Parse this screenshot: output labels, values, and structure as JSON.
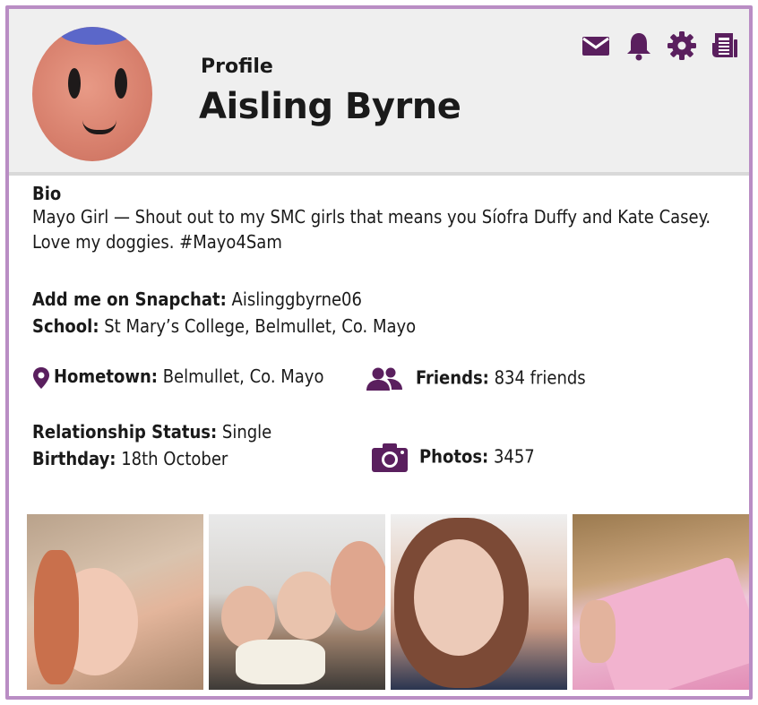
{
  "header": {
    "subtitle": "Profile",
    "name": "Aisling Byrne",
    "toolbar": [
      {
        "icon": "envelope-icon"
      },
      {
        "icon": "bell-icon"
      },
      {
        "icon": "gear-icon"
      },
      {
        "icon": "newspaper-icon"
      }
    ]
  },
  "bio": {
    "title": "Bio",
    "text": "Mayo Girl — Shout out to my SMC girls that means you Síofra Duffy and Kate Casey. Love my doggies. #Mayo4Sam"
  },
  "details": {
    "snapchat_label": "Add me on Snapchat:",
    "snapchat_value": "Aislinggbyrne06",
    "school_label": "School:",
    "school_value": "St Mary’s College, Belmullet, Co. Mayo",
    "hometown_label": "Hometown:",
    "hometown_value": "Belmullet, Co. Mayo",
    "friends_label": "Friends:",
    "friends_value": "834 friends",
    "relationship_label": "Relationship Status:",
    "relationship_value": "Single",
    "birthday_label": "Birthday:",
    "birthday_value": "18th October",
    "photos_label": "Photos:",
    "photos_value": "3457"
  },
  "colors": {
    "accent": "#5a1f5e",
    "border": "#b98dc4",
    "header_bg": "#efefef"
  }
}
